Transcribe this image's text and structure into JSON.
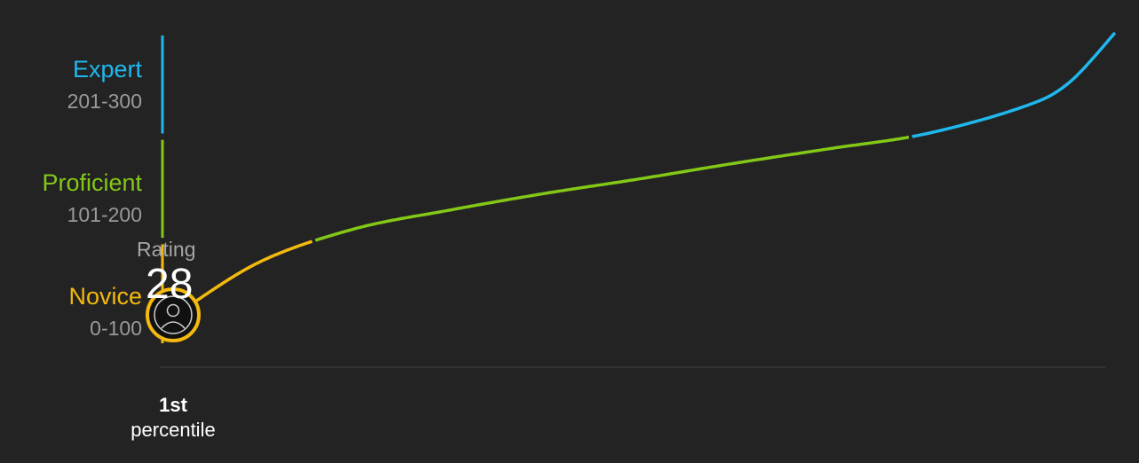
{
  "tiers": [
    {
      "name": "Expert",
      "range": "201-300",
      "min": 201,
      "max": 300,
      "color": "#1fb8ee"
    },
    {
      "name": "Proficient",
      "range": "101-200",
      "min": 101,
      "max": 200,
      "color": "#84c817"
    },
    {
      "name": "Novice",
      "range": "0-100",
      "min": 0,
      "max": 100,
      "color": "#f4b90e"
    }
  ],
  "rating": {
    "label": "Rating",
    "value": "28"
  },
  "percentile": {
    "rank": "1st",
    "label": "percentile"
  },
  "colors": {
    "background": "#232323",
    "baseline": "#3a3a3a",
    "marker_ring": "#f4b90e",
    "marker_fill": "#111111"
  },
  "icons": {
    "marker": "user-avatar-icon"
  },
  "chart_data": {
    "type": "line",
    "description_series": "rating distribution curve by percentile",
    "x": [
      1,
      10,
      20,
      30,
      40,
      50,
      60,
      70,
      80,
      90,
      95,
      100
    ],
    "y": [
      28,
      80,
      112,
      130,
      146,
      160,
      175,
      189,
      203,
      228,
      251,
      300
    ],
    "xlim": [
      1,
      100
    ],
    "ylim": [
      0,
      300
    ],
    "bands": [
      {
        "name": "Novice",
        "from": 0,
        "to": 100
      },
      {
        "name": "Proficient",
        "from": 101,
        "to": 200
      },
      {
        "name": "Expert",
        "from": 201,
        "to": 300
      }
    ],
    "marker": {
      "x": 1,
      "y": 28
    }
  }
}
